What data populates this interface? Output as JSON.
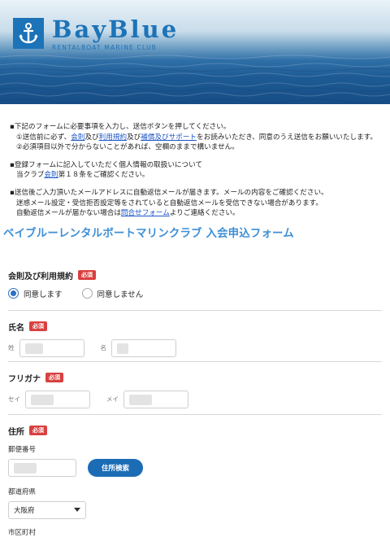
{
  "header": {
    "brand": "BayBlue",
    "tagline": "RENTALBOAT MARINE CLUB",
    "logo_icon": "anchor-icon",
    "accent": "#1c73b8"
  },
  "notes": {
    "p1_line1": "▪下記のフォームに必要事項を入力し、送信ボタンを押してください。",
    "p1_line2_a": "①送信前に必ず、",
    "p1_line2_link1": "会則",
    "p1_line2_b": "及び",
    "p1_line2_link2": "利用規約",
    "p1_line2_c": "及び",
    "p1_line2_link3": "補償及びサポート",
    "p1_line2_d": "をお読みいただき、同意のうえ送信をお願いいたします。",
    "p1_line3": "②必須項目以外で分からないことがあれば、空欄のままで構いません。",
    "p2_line1": "▪登録フォームに記入していただく個人情報の取扱いについて",
    "p2_line2_a": "当クラブ",
    "p2_line2_link": "会則",
    "p2_line2_b": "第１８条をご確認ください。",
    "p3_line1": "▪送信後ご入力頂いたメールアドレスに自動返信メールが届きます。メールの内容をご確認ください。",
    "p3_line2": "迷惑メール設定・受信拒否設定等をされていると自動返信メールを受信できない場合があります。",
    "p3_line3_a": "自動返信メールが届かない場合は",
    "p3_line3_link": "問合せフォーム",
    "p3_line3_b": "よりご連絡ください。"
  },
  "form": {
    "title": "ベイブルーレンタルボートマリンクラブ 入会申込フォーム",
    "required_badge": "必須",
    "agreement": {
      "label": "会則及び利用規約",
      "option_yes": "同意します",
      "option_no": "同意しません",
      "selected": "同意します"
    },
    "name": {
      "label": "氏名",
      "sei_label": "姓",
      "mei_label": "名"
    },
    "furigana": {
      "label": "フリガナ",
      "sei_label": "セイ",
      "mei_label": "メイ"
    },
    "address": {
      "label": "住所",
      "postal_label": "郵便番号",
      "search_button": "住所検索",
      "pref_label": "都道府県",
      "pref_value": "大阪府",
      "city_label": "市区町村"
    }
  }
}
